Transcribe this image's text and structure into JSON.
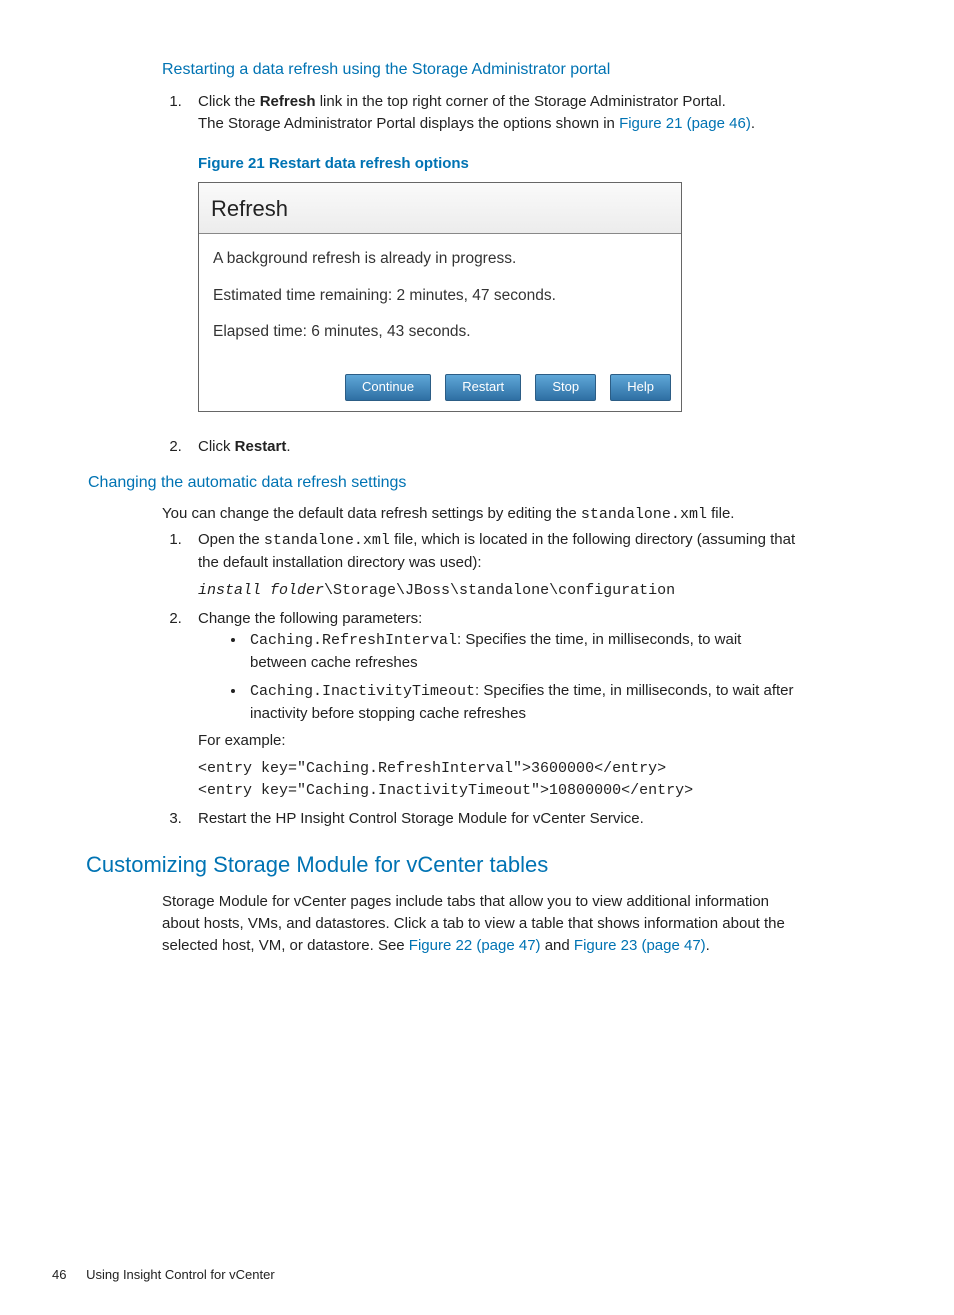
{
  "section1": {
    "title": "Restarting a data refresh using the Storage Administrator portal",
    "step1a": "Click the ",
    "step1bold": "Refresh",
    "step1b": " link in the top right corner of the Storage Administrator Portal.",
    "step1c": "The Storage Administrator Portal displays the options shown in ",
    "figlink": "Figure 21 (page 46)",
    "figcaption": "Figure 21 Restart data refresh options",
    "step2a": "Click ",
    "step2bold": "Restart",
    "step2b": "."
  },
  "refreshDialog": {
    "title": "Refresh",
    "line1": "A background refresh is already in progress.",
    "line2": "Estimated time remaining: 2 minutes, 47 seconds.",
    "line3": "Elapsed time: 6 minutes, 43 seconds.",
    "btnContinue": "Continue",
    "btnRestart": "Restart",
    "btnStop": "Stop",
    "btnHelp": "Help"
  },
  "section2": {
    "title": "Changing the automatic data refresh settings",
    "intro_a": "You can change the default data refresh settings by editing the ",
    "intro_code": "standalone.xml",
    "intro_b": " file.",
    "step1a": "Open the ",
    "step1code": "standalone.xml",
    "step1b": " file, which is located in the following directory (assuming that the default installation directory was used):",
    "path_a": "install folder",
    "path_b": "\\Storage\\JBoss\\standalone\\configuration",
    "step2": "Change the following parameters:",
    "bullet1code": "Caching.RefreshInterval",
    "bullet1text": ": Specifies the time, in milliseconds, to wait between cache refreshes",
    "bullet2code": "Caching.InactivityTimeout",
    "bullet2text": ": Specifies the time, in milliseconds, to wait after inactivity before stopping cache refreshes",
    "forExample": "For example:",
    "example": "<entry key=\"Caching.RefreshInterval\">3600000</entry>\n<entry key=\"Caching.InactivityTimeout\">10800000</entry>",
    "step3": "Restart the HP Insight Control Storage Module for vCenter Service."
  },
  "section3": {
    "title": "Customizing Storage Module for vCenter tables",
    "p_a": "Storage Module for vCenter pages include tabs that allow you to view additional information about hosts, VMs, and datastores. Click a tab to view a table that shows information about the selected host, VM, or datastore. See ",
    "link1": "Figure 22 (page 47)",
    "p_b": " and ",
    "link2": "Figure 23 (page 47)",
    "p_c": "."
  },
  "footer": {
    "page": "46",
    "text": "Using Insight Control for vCenter"
  }
}
